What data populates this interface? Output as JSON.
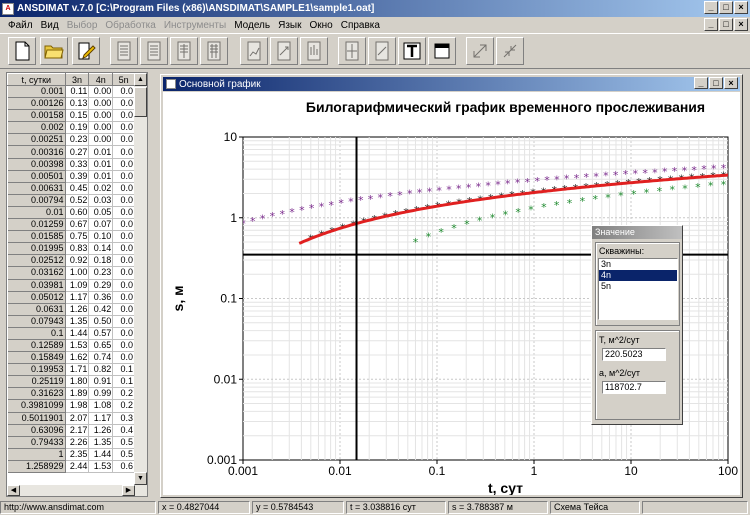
{
  "window": {
    "title": "ANSDIMAT v.7.0  [C:\\Program Files (x86)\\ANSDIMAT\\SAMPLE1\\sample1.oat]"
  },
  "menu": [
    {
      "label": "Файл",
      "enabled": true
    },
    {
      "label": "Вид",
      "enabled": true
    },
    {
      "label": "Выбор",
      "enabled": false
    },
    {
      "label": "Обработка",
      "enabled": false
    },
    {
      "label": "Инструменты",
      "enabled": false
    },
    {
      "label": "Модель",
      "enabled": true
    },
    {
      "label": "Язык",
      "enabled": true
    },
    {
      "label": "Окно",
      "enabled": true
    },
    {
      "label": "Справка",
      "enabled": true
    }
  ],
  "toolbar": [
    {
      "icon": "new-document-icon",
      "enabled": true
    },
    {
      "icon": "open-folder-icon",
      "enabled": true
    },
    {
      "icon": "edit-document-icon",
      "enabled": true
    },
    {
      "icon": "table-icon",
      "enabled": false
    },
    {
      "icon": "table-icon",
      "enabled": false
    },
    {
      "icon": "table-icon",
      "enabled": false
    },
    {
      "icon": "table-icon",
      "enabled": false
    },
    {
      "icon": "chart-page-icon",
      "enabled": false
    },
    {
      "icon": "chart-page-icon",
      "enabled": false
    },
    {
      "icon": "chart-page-icon",
      "enabled": false
    },
    {
      "icon": "chart-page-icon",
      "enabled": false
    },
    {
      "icon": "chart-page-icon",
      "enabled": false
    },
    {
      "icon": "text-icon",
      "enabled": true
    },
    {
      "icon": "window-icon",
      "enabled": true
    },
    {
      "icon": "expand-icon",
      "enabled": false
    },
    {
      "icon": "shrink-icon",
      "enabled": false
    }
  ],
  "table": {
    "headers": [
      "t, сутки",
      "3n",
      "4n",
      "5n"
    ],
    "rows": [
      [
        "0.001",
        "0.11",
        "0.00",
        "0.0"
      ],
      [
        "0.00126",
        "0.13",
        "0.00",
        "0.0"
      ],
      [
        "0.00158",
        "0.15",
        "0.00",
        "0.0"
      ],
      [
        "0.002",
        "0.19",
        "0.00",
        "0.0"
      ],
      [
        "0.00251",
        "0.23",
        "0.00",
        "0.0"
      ],
      [
        "0.00316",
        "0.27",
        "0.01",
        "0.0"
      ],
      [
        "0.00398",
        "0.33",
        "0.01",
        "0.0"
      ],
      [
        "0.00501",
        "0.39",
        "0.01",
        "0.0"
      ],
      [
        "0.00631",
        "0.45",
        "0.02",
        "0.0"
      ],
      [
        "0.00794",
        "0.52",
        "0.03",
        "0.0"
      ],
      [
        "0.01",
        "0.60",
        "0.05",
        "0.0"
      ],
      [
        "0.01259",
        "0.67",
        "0.07",
        "0.0"
      ],
      [
        "0.01585",
        "0.75",
        "0.10",
        "0.0"
      ],
      [
        "0.01995",
        "0.83",
        "0.14",
        "0.0"
      ],
      [
        "0.02512",
        "0.92",
        "0.18",
        "0.0"
      ],
      [
        "0.03162",
        "1.00",
        "0.23",
        "0.0"
      ],
      [
        "0.03981",
        "1.09",
        "0.29",
        "0.0"
      ],
      [
        "0.05012",
        "1.17",
        "0.36",
        "0.0"
      ],
      [
        "0.0631",
        "1.26",
        "0.42",
        "0.0"
      ],
      [
        "0.07943",
        "1.35",
        "0.50",
        "0.0"
      ],
      [
        "0.1",
        "1.44",
        "0.57",
        "0.0"
      ],
      [
        "0.12589",
        "1.53",
        "0.65",
        "0.0"
      ],
      [
        "0.15849",
        "1.62",
        "0.74",
        "0.0"
      ],
      [
        "0.19953",
        "1.71",
        "0.82",
        "0.1"
      ],
      [
        "0.25119",
        "1.80",
        "0.91",
        "0.1"
      ],
      [
        "0.31623",
        "1.89",
        "0.99",
        "0.2"
      ],
      [
        "0.3981099",
        "1.98",
        "1.08",
        "0.2"
      ],
      [
        "0.5011901",
        "2.07",
        "1.17",
        "0.3"
      ],
      [
        "0.63096",
        "2.17",
        "1.26",
        "0.4"
      ],
      [
        "0.79433",
        "2.26",
        "1.35",
        "0.5"
      ],
      [
        "1",
        "2.35",
        "1.44",
        "0.5"
      ],
      [
        "1.258929",
        "2.44",
        "1.53",
        "0.6"
      ]
    ]
  },
  "graph_window": {
    "title": "Основной график"
  },
  "chart_data": {
    "type": "scatter",
    "title": "Билогарифмический график временного прослеживания",
    "xlabel": "t, сут",
    "ylabel": "s, м",
    "xscale": "log",
    "yscale": "log",
    "xlim": [
      0.001,
      100
    ],
    "ylim": [
      0.001,
      10
    ],
    "x_ticks": [
      "0.001",
      "0.01",
      "0.1",
      "1",
      "10",
      "100"
    ],
    "y_ticks": [
      "0.001",
      "0.01",
      "0.1",
      "1",
      "10"
    ],
    "grid": true,
    "crosshair": {
      "x": 0.0148,
      "y": 0.35
    },
    "series": [
      {
        "id": "3n",
        "marker": "star",
        "color": "#7a2a8c",
        "x_from": 0.001,
        "x_to": 90,
        "points": 50,
        "a": 0.3
      },
      {
        "id": "4n",
        "marker": "star",
        "color": "#111111",
        "x_from": 0.005,
        "x_to": 90,
        "points": 40,
        "a": 4.5
      },
      {
        "id": "5n",
        "marker": "star",
        "color": "#1e8a2e",
        "x_from": 0.06,
        "x_to": 90,
        "points": 25,
        "a": 65
      }
    ],
    "model_curve": {
      "color": "#e02020",
      "x_from": 0.0038,
      "x_to": 100,
      "a": 4.5
    }
  },
  "values_panel": {
    "title": "Значение",
    "wells_label": "Скважины:",
    "wells": [
      "3n",
      "4n",
      "5n"
    ],
    "selected": "4n",
    "t_label": "T, м^2/сут",
    "t_value": "220.5023",
    "a_label": "a, м^2/сут",
    "a_value": "118702.7"
  },
  "status": {
    "url": "http://www.ansdimat.com",
    "x": "x = 0.4827044",
    "y": "y = 0.5784543",
    "t": "t = 3.038816 сут",
    "s": "s = 3.788387 м",
    "scheme": "Схема Тейса"
  }
}
